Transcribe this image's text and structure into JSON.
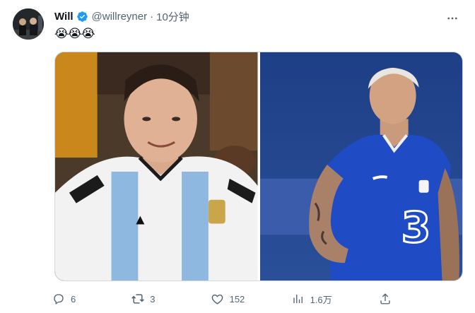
{
  "tweet": {
    "author": {
      "display_name": "Will",
      "handle": "@willreyner",
      "verified": true,
      "avatar_icon": "avatar-photo"
    },
    "separator": "·",
    "timestamp": "10分钟",
    "text": "😭😭😭",
    "media": [
      {
        "description_icon": "photo-argentina-player"
      },
      {
        "description_icon": "photo-chelsea-player"
      }
    ],
    "actions": {
      "reply_count": "6",
      "retweet_count": "3",
      "like_count": "152",
      "views_count": "1.6万"
    }
  },
  "colors": {
    "accent": "#1d9bf0",
    "muted_text": "#536471",
    "primary_text": "#0f1419"
  }
}
